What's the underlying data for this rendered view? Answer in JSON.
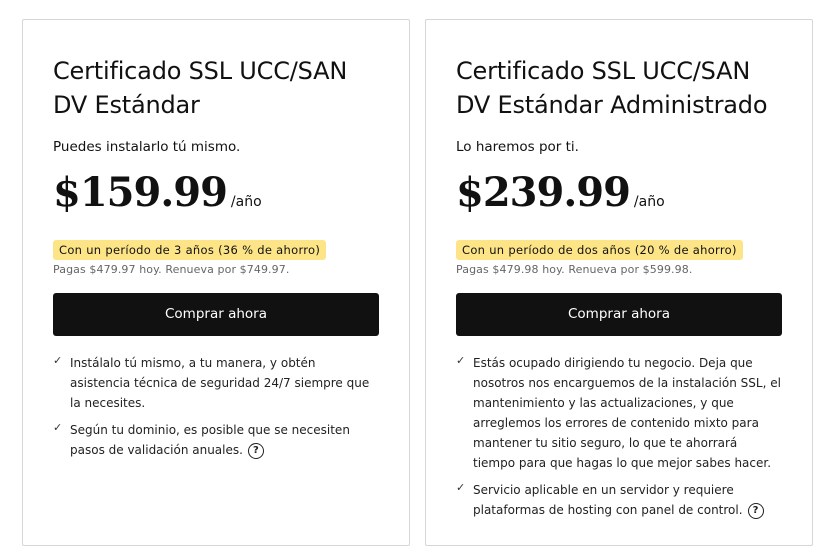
{
  "cards": [
    {
      "title_line1": "Certificado SSL UCC/SAN",
      "title_line2": "DV Estándar",
      "subtitle": "Puedes instalarlo tú mismo.",
      "price": "$159.99",
      "per": "/año",
      "badge": "Con un período de 3 años (36 % de ahorro)",
      "renew": "Pagas $479.97 hoy. Renueva por $749.97.",
      "buy_label": "Comprar ahora",
      "features": [
        "Instálalo tú mismo, a tu manera, y obtén asistencia técnica de seguridad 24/7 siempre que la necesites.",
        "Según tu dominio, es posible que se necesiten pasos de validación anuales."
      ]
    },
    {
      "title_line1": "Certificado SSL UCC/SAN",
      "title_line2": "DV Estándar Administrado",
      "subtitle": "Lo haremos por ti.",
      "price": "$239.99",
      "per": "/año",
      "badge": "Con un período de dos años (20 % de ahorro)",
      "renew": "Pagas $479.98 hoy. Renueva por $599.98.",
      "buy_label": "Comprar ahora",
      "features": [
        "Estás ocupado dirigiendo tu negocio. Deja que nosotros nos encarguemos de la instalación SSL, el mantenimiento y las actualizaciones, y que arreglemos los errores de contenido mixto para mantener tu sitio seguro, lo que te ahorrará tiempo para que hagas lo que mejor sabes hacer.",
        "Servicio aplicable en un servidor y requiere plataformas de hosting con panel de control."
      ]
    }
  ],
  "icons": {
    "check": "check-icon",
    "help": "question-circle-icon",
    "check_glyph": "✓",
    "help_glyph": "?"
  }
}
